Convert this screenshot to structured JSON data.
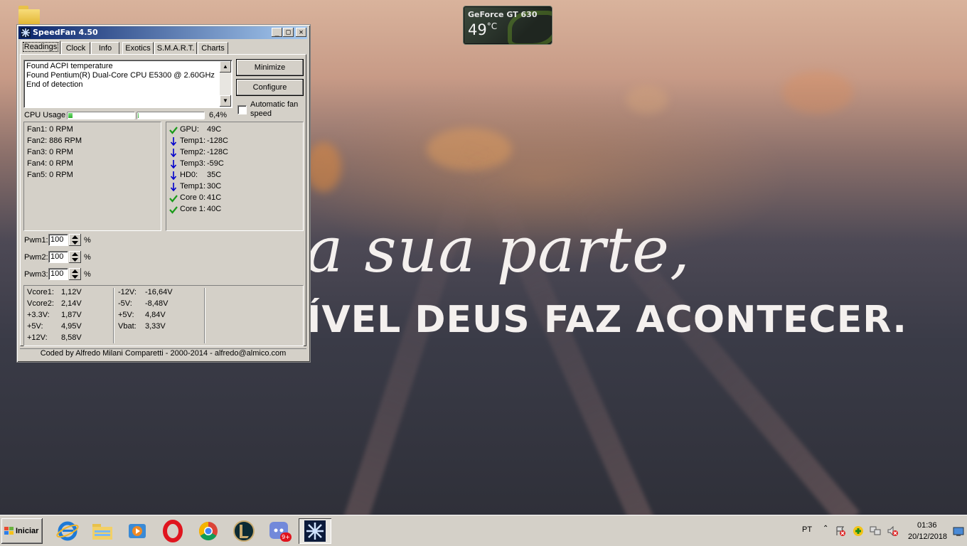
{
  "wallpaper": {
    "quote_line1": "a sua parte,",
    "quote_line2": "ÍVEL DEUS FAZ ACONTECER."
  },
  "gpu_gadget": {
    "name": "GeForce GT 630",
    "temperature": "49",
    "unit": "°C"
  },
  "window": {
    "title": "SpeedFan 4.50",
    "controls": {
      "minimize": "_",
      "maximize": "□",
      "close": "✕"
    },
    "tabs": [
      {
        "label": "Readings",
        "active": true
      },
      {
        "label": "Clock"
      },
      {
        "label": "Info"
      },
      {
        "label": "Exotics"
      },
      {
        "label": "S.M.A.R.T."
      },
      {
        "label": "Charts"
      }
    ],
    "log": [
      "Found ACPI temperature",
      "Found Pentium(R) Dual-Core CPU E5300 @ 2.60GHz",
      "End of detection"
    ],
    "buttons": {
      "minimize": "Minimize",
      "configure": "Configure"
    },
    "auto_fan_label": "Automatic fan speed",
    "auto_fan_checked": false,
    "cpu_usage": {
      "label": "CPU Usage",
      "core1_fraction": 0.06,
      "core2_fraction": 0.01,
      "percent_text": "6,4%"
    },
    "fans": [
      "Fan1: 0 RPM",
      "Fan2: 886 RPM",
      "Fan3: 0 RPM",
      "Fan4: 0 RPM",
      "Fan5: 0 RPM"
    ],
    "temps": [
      {
        "label": "GPU:",
        "value": "49C",
        "status": "ok-icon"
      },
      {
        "label": "Temp1:",
        "value": "-128C",
        "status": "down-arrow-icon"
      },
      {
        "label": "Temp2:",
        "value": "-128C",
        "status": "down-arrow-icon"
      },
      {
        "label": "Temp3:",
        "value": "-59C",
        "status": "down-arrow-icon"
      },
      {
        "label": "HD0:",
        "value": "35C",
        "status": "down-arrow-icon"
      },
      {
        "label": "Temp1:",
        "value": "30C",
        "status": "down-arrow-icon"
      },
      {
        "label": "Core 0:",
        "value": "41C",
        "status": "ok-icon"
      },
      {
        "label": "Core 1:",
        "value": "40C",
        "status": "ok-icon"
      }
    ],
    "pwm": [
      {
        "label": "Pwm1:",
        "value": "100",
        "unit": "%"
      },
      {
        "label": "Pwm2:",
        "value": "100",
        "unit": "%"
      },
      {
        "label": "Pwm3:",
        "value": "100",
        "unit": "%"
      }
    ],
    "voltages_left": [
      {
        "label": "Vcore1:",
        "value": "1,12V"
      },
      {
        "label": "Vcore2:",
        "value": "2,14V"
      },
      {
        "label": "+3.3V:",
        "value": "1,87V"
      },
      {
        "label": "+5V:",
        "value": "4,95V"
      },
      {
        "label": "+12V:",
        "value": "8,58V"
      }
    ],
    "voltages_right": [
      {
        "label": "-12V:",
        "value": "-16,64V"
      },
      {
        "label": "-5V:",
        "value": "-8,48V"
      },
      {
        "label": "+5V:",
        "value": "4,84V"
      },
      {
        "label": "Vbat:",
        "value": "3,33V"
      }
    ],
    "status": "Coded by Alfredo Milani Comparetti - 2000-2014 - alfredo@almico.com"
  },
  "taskbar": {
    "start_label": "Iniciar",
    "apps": [
      "internet-explorer-icon",
      "file-explorer-icon",
      "media-player-icon",
      "opera-icon",
      "chrome-icon",
      "league-of-legends-icon",
      "discord-icon",
      "speedfan-icon"
    ],
    "discord_badge": "9+",
    "language": "PT",
    "time": "01:36",
    "date": "20/12/2018"
  },
  "colors": {
    "window_face": "#d4d0c8",
    "title_start": "#0a246a",
    "title_end": "#a6caf0",
    "ok_green": "#1a9a1a",
    "down_blue": "#0000cc"
  }
}
